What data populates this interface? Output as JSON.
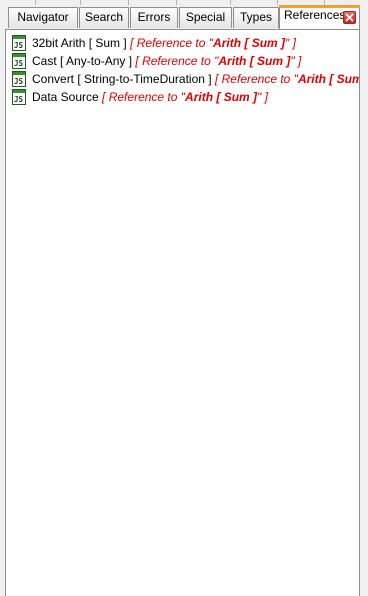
{
  "tabs": [
    {
      "label": "Navigator",
      "active": false
    },
    {
      "label": "Search",
      "active": false
    },
    {
      "label": "Errors",
      "active": false
    },
    {
      "label": "Special",
      "active": false
    },
    {
      "label": "Types",
      "active": false
    },
    {
      "label": "References",
      "active": true
    }
  ],
  "icons": {
    "close": "close-icon",
    "item": "js-file-icon"
  },
  "colors": {
    "reference_text": "#e00000",
    "active_tab_accent": "#f0a030",
    "icon_green": "#3c8f2f"
  },
  "references": [
    {
      "name": "32bit Arith [ Sum ]",
      "ref_open": "[ ",
      "ref_prefix": "Reference to \"",
      "ref_target": "Arith [ Sum ]",
      "ref_suffix": "\" ]"
    },
    {
      "name": "Cast [ Any-to-Any ]",
      "ref_open": "[ ",
      "ref_prefix": "Reference to \"",
      "ref_target": "Arith [ Sum ]",
      "ref_suffix": "\" ]"
    },
    {
      "name": "Convert [ String-to-TimeDuration ]",
      "ref_open": "[ ",
      "ref_prefix": "Reference to \"",
      "ref_target": "Arith [ Sum ]",
      "ref_suffix": "\" ]"
    },
    {
      "name": "Data Source",
      "ref_open": "[ ",
      "ref_prefix": "Reference to \"",
      "ref_target": "Arith [ Sum ]",
      "ref_suffix": "\" ]"
    }
  ]
}
